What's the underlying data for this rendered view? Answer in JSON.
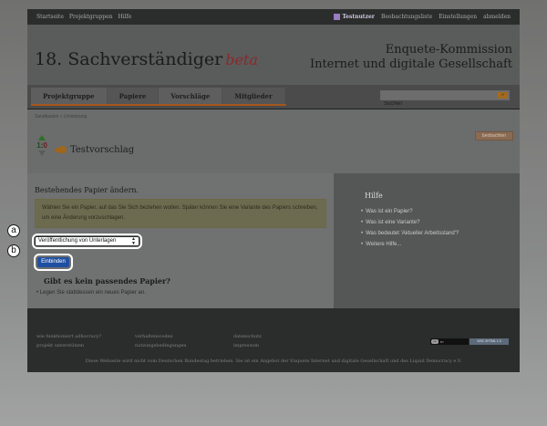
{
  "topnav": {
    "left_links": [
      "Startseite",
      "Projektgruppen",
      "Hilfe"
    ],
    "user": "Testnutzer",
    "right_links": [
      "Beobachtungsliste",
      "Einstellungen",
      "abmelden"
    ]
  },
  "header": {
    "brand": "18. Sachverständiger",
    "beta": "beta",
    "enquete_line1": "Enquete-Kommission",
    "enquete_line2": "Internet und digitale Gesellschaft"
  },
  "nav": {
    "tabs": [
      "Projektgruppe",
      "Papiere",
      "Vorschläge",
      "Mitglieder"
    ],
    "search_placeholder": "Suchen",
    "search_button": ">"
  },
  "proposal": {
    "breadcrumb": "Sandkasten » Umsetzung",
    "observe_button": "beobachten",
    "pro_votes": "1",
    "separator": ":",
    "con_votes": "0",
    "title": "Testvorschlag"
  },
  "main": {
    "heading": "Bestehendes Papier ändern.",
    "note": "Wählen Sie ein Papier, auf das Sie Sich beziehen wollen. Später können Sie eine Variante des Papiers schreiben, um eine Änderung vorzuschlagen.",
    "select_value": "Veröffentlichung von Unterlagen",
    "button": "Einbinden",
    "nopaper_title": "Gibt es kein passendes Papier?",
    "nopaper_item": "Legen Sie stattdessen ein neues Papier an."
  },
  "help": {
    "title": "Hilfe",
    "items": [
      "Was ist ein Papier?",
      "Was ist eine Variante?",
      "Was bedeutet 'Aktueller Arbeitsstand'?",
      "Weitere Hilfe..."
    ]
  },
  "footer": {
    "col1": [
      "wie funktioniert adhocracy?",
      "projekt unterstützen"
    ],
    "col2": [
      "verhaltenscodex",
      "nutzungsbedingungen"
    ],
    "col3": [
      "datenschutz",
      "impressum"
    ],
    "cc_label": "BY",
    "w3_label": "W3C XHTML 1.0",
    "note": "Diese Webseite wird nicht vom Deutschen Bundestag betrieben. Sie ist ein Angebot der Enquete Internet und digitale Gesellschaft und des Liquid Democracy e.V."
  },
  "markers": {
    "a": "a",
    "b": "b"
  }
}
